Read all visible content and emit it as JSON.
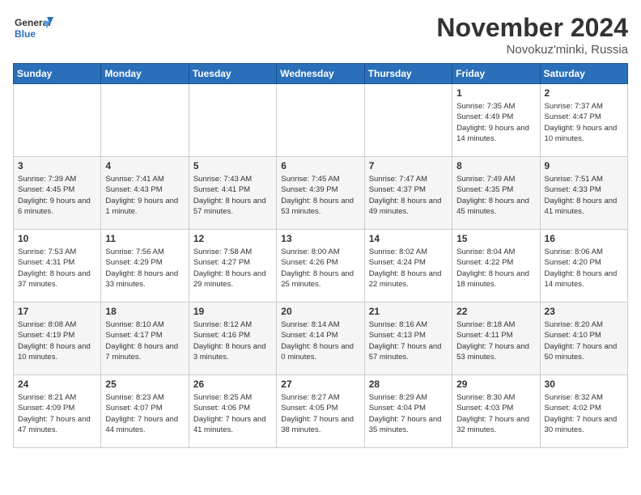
{
  "header": {
    "logo_line1": "General",
    "logo_line2": "Blue",
    "month": "November 2024",
    "location": "Novokuz'minki, Russia"
  },
  "weekdays": [
    "Sunday",
    "Monday",
    "Tuesday",
    "Wednesday",
    "Thursday",
    "Friday",
    "Saturday"
  ],
  "weeks": [
    [
      {
        "day": "",
        "info": ""
      },
      {
        "day": "",
        "info": ""
      },
      {
        "day": "",
        "info": ""
      },
      {
        "day": "",
        "info": ""
      },
      {
        "day": "",
        "info": ""
      },
      {
        "day": "1",
        "info": "Sunrise: 7:35 AM\nSunset: 4:49 PM\nDaylight: 9 hours\nand 14 minutes."
      },
      {
        "day": "2",
        "info": "Sunrise: 7:37 AM\nSunset: 4:47 PM\nDaylight: 9 hours\nand 10 minutes."
      }
    ],
    [
      {
        "day": "3",
        "info": "Sunrise: 7:39 AM\nSunset: 4:45 PM\nDaylight: 9 hours\nand 6 minutes."
      },
      {
        "day": "4",
        "info": "Sunrise: 7:41 AM\nSunset: 4:43 PM\nDaylight: 9 hours\nand 1 minute."
      },
      {
        "day": "5",
        "info": "Sunrise: 7:43 AM\nSunset: 4:41 PM\nDaylight: 8 hours\nand 57 minutes."
      },
      {
        "day": "6",
        "info": "Sunrise: 7:45 AM\nSunset: 4:39 PM\nDaylight: 8 hours\nand 53 minutes."
      },
      {
        "day": "7",
        "info": "Sunrise: 7:47 AM\nSunset: 4:37 PM\nDaylight: 8 hours\nand 49 minutes."
      },
      {
        "day": "8",
        "info": "Sunrise: 7:49 AM\nSunset: 4:35 PM\nDaylight: 8 hours\nand 45 minutes."
      },
      {
        "day": "9",
        "info": "Sunrise: 7:51 AM\nSunset: 4:33 PM\nDaylight: 8 hours\nand 41 minutes."
      }
    ],
    [
      {
        "day": "10",
        "info": "Sunrise: 7:53 AM\nSunset: 4:31 PM\nDaylight: 8 hours\nand 37 minutes."
      },
      {
        "day": "11",
        "info": "Sunrise: 7:56 AM\nSunset: 4:29 PM\nDaylight: 8 hours\nand 33 minutes."
      },
      {
        "day": "12",
        "info": "Sunrise: 7:58 AM\nSunset: 4:27 PM\nDaylight: 8 hours\nand 29 minutes."
      },
      {
        "day": "13",
        "info": "Sunrise: 8:00 AM\nSunset: 4:26 PM\nDaylight: 8 hours\nand 25 minutes."
      },
      {
        "day": "14",
        "info": "Sunrise: 8:02 AM\nSunset: 4:24 PM\nDaylight: 8 hours\nand 22 minutes."
      },
      {
        "day": "15",
        "info": "Sunrise: 8:04 AM\nSunset: 4:22 PM\nDaylight: 8 hours\nand 18 minutes."
      },
      {
        "day": "16",
        "info": "Sunrise: 8:06 AM\nSunset: 4:20 PM\nDaylight: 8 hours\nand 14 minutes."
      }
    ],
    [
      {
        "day": "17",
        "info": "Sunrise: 8:08 AM\nSunset: 4:19 PM\nDaylight: 8 hours\nand 10 minutes."
      },
      {
        "day": "18",
        "info": "Sunrise: 8:10 AM\nSunset: 4:17 PM\nDaylight: 8 hours\nand 7 minutes."
      },
      {
        "day": "19",
        "info": "Sunrise: 8:12 AM\nSunset: 4:16 PM\nDaylight: 8 hours\nand 3 minutes."
      },
      {
        "day": "20",
        "info": "Sunrise: 8:14 AM\nSunset: 4:14 PM\nDaylight: 8 hours\nand 0 minutes."
      },
      {
        "day": "21",
        "info": "Sunrise: 8:16 AM\nSunset: 4:13 PM\nDaylight: 7 hours\nand 57 minutes."
      },
      {
        "day": "22",
        "info": "Sunrise: 8:18 AM\nSunset: 4:11 PM\nDaylight: 7 hours\nand 53 minutes."
      },
      {
        "day": "23",
        "info": "Sunrise: 8:20 AM\nSunset: 4:10 PM\nDaylight: 7 hours\nand 50 minutes."
      }
    ],
    [
      {
        "day": "24",
        "info": "Sunrise: 8:21 AM\nSunset: 4:09 PM\nDaylight: 7 hours\nand 47 minutes."
      },
      {
        "day": "25",
        "info": "Sunrise: 8:23 AM\nSunset: 4:07 PM\nDaylight: 7 hours\nand 44 minutes."
      },
      {
        "day": "26",
        "info": "Sunrise: 8:25 AM\nSunset: 4:06 PM\nDaylight: 7 hours\nand 41 minutes."
      },
      {
        "day": "27",
        "info": "Sunrise: 8:27 AM\nSunset: 4:05 PM\nDaylight: 7 hours\nand 38 minutes."
      },
      {
        "day": "28",
        "info": "Sunrise: 8:29 AM\nSunset: 4:04 PM\nDaylight: 7 hours\nand 35 minutes."
      },
      {
        "day": "29",
        "info": "Sunrise: 8:30 AM\nSunset: 4:03 PM\nDaylight: 7 hours\nand 32 minutes."
      },
      {
        "day": "30",
        "info": "Sunrise: 8:32 AM\nSunset: 4:02 PM\nDaylight: 7 hours\nand 30 minutes."
      }
    ]
  ]
}
